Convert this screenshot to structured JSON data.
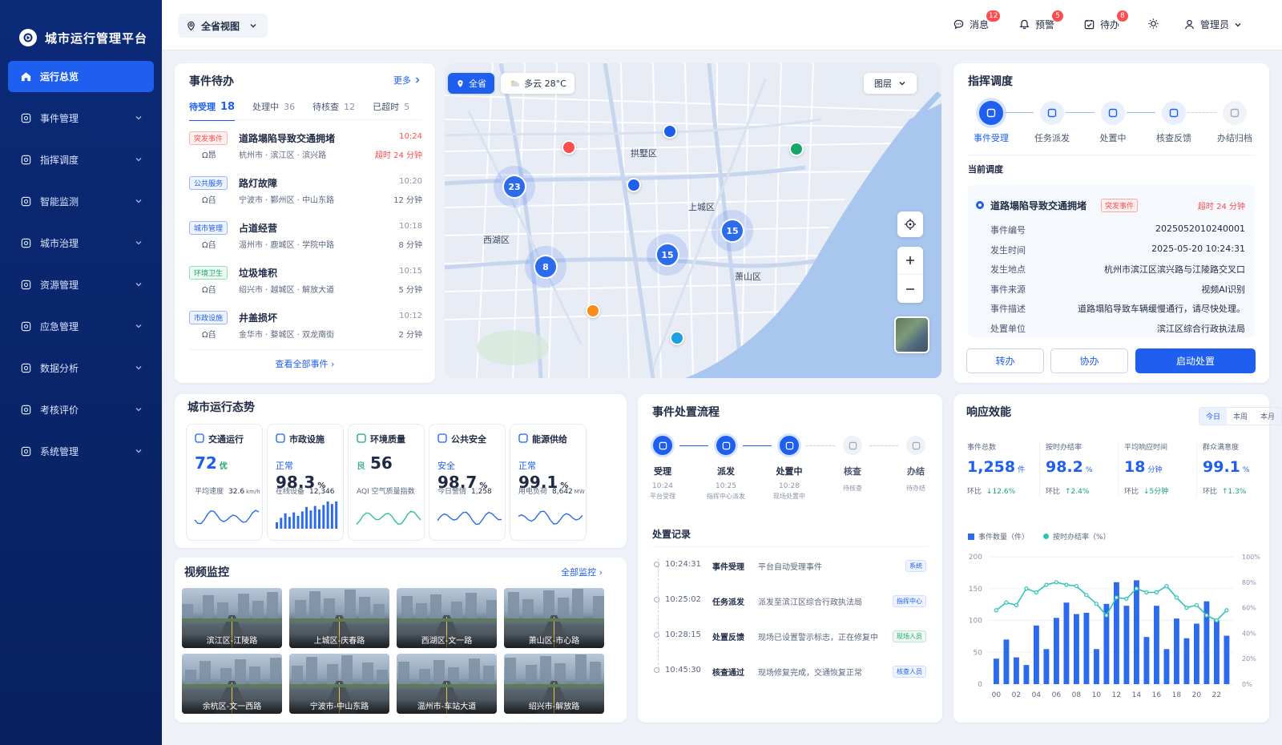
{
  "app": {
    "title": "城市运行管理平台"
  },
  "sidebar": {
    "items": [
      {
        "label": "运行总览",
        "icon": "home-icon",
        "active": true
      },
      {
        "label": "事件管理",
        "icon": "clipboard-icon"
      },
      {
        "label": "指挥调度",
        "icon": "command-icon"
      },
      {
        "label": "智能监测",
        "icon": "monitor-icon"
      },
      {
        "label": "城市治理",
        "icon": "city-icon"
      },
      {
        "label": "资源管理",
        "icon": "resource-icon"
      },
      {
        "label": "应急管理",
        "icon": "shield-icon"
      },
      {
        "label": "数据分析",
        "icon": "chart-icon"
      },
      {
        "label": "考核评价",
        "icon": "check-icon"
      },
      {
        "label": "系统管理",
        "icon": "gear-icon"
      }
    ]
  },
  "topbar": {
    "region": "全省视图",
    "messages": {
      "label": "消息",
      "count": "12"
    },
    "alerts": {
      "label": "预警",
      "count": "5"
    },
    "todo": {
      "label": "待办",
      "count": "8"
    },
    "user": "管理员"
  },
  "events": {
    "title": "事件待办",
    "more": "更多",
    "tabs": [
      {
        "label": "待受理",
        "count": "18"
      },
      {
        "label": "处理中",
        "count": "36"
      },
      {
        "label": "待核查",
        "count": "12"
      },
      {
        "label": "已超时",
        "count": "5"
      }
    ],
    "items": [
      {
        "tag": "突发事件",
        "tagColor": "#ff4d4f",
        "title": "道路塌陷导致交通拥堵",
        "sub": "Ω昂",
        "loc": "杭州市 · 滨江区 · 滨兴路",
        "time": "10:24",
        "dur": "超时 24 分钟",
        "durColor": "#ff4d4f"
      },
      {
        "tag": "公共服务",
        "tagColor": "#1e5ff0",
        "title": "路灯故障",
        "sub": "Ω臽",
        "loc": "宁波市 · 鄞州区 · 中山东路",
        "time": "10:20",
        "dur": "12 分钟",
        "durColor": "#5b6680"
      },
      {
        "tag": "城市管理",
        "tagColor": "#1e5ff0",
        "title": "占道经营",
        "sub": "Ω臽",
        "loc": "温州市 · 鹿城区 · 学院中路",
        "time": "10:18",
        "dur": "8 分钟",
        "durColor": "#5b6680"
      },
      {
        "tag": "环境卫生",
        "tagColor": "#17a66a",
        "title": "垃圾堆积",
        "sub": "Ω臽",
        "loc": "绍兴市 · 越城区 · 解放大道",
        "time": "10:15",
        "dur": "5 分钟",
        "durColor": "#5b6680"
      },
      {
        "tag": "市政设施",
        "tagColor": "#1e5ff0",
        "title": "井盖损坏",
        "sub": "Ω臽",
        "loc": "金华市 · 婺城区 · 双龙南街",
        "time": "10:12",
        "dur": "2 分钟",
        "durColor": "#5b6680"
      }
    ],
    "view_all": "查看全部事件"
  },
  "map": {
    "scope": "全省",
    "weather": "多云 28°C",
    "layers": "图层",
    "districts": [
      "拱墅区",
      "上城区",
      "西湖区",
      "萧山区"
    ],
    "clusters": [
      "23",
      "15",
      "15",
      "8"
    ]
  },
  "dispatch": {
    "title": "指挥调度",
    "steps": [
      "事件受理",
      "任务派发",
      "处置中",
      "核查反馈",
      "办结归档"
    ],
    "current_label": "当前调度",
    "event_title": "道路塌陷导致交通拥堵",
    "event_tag": "突发事件",
    "event_overdue": "超时 24 分钟",
    "fields": [
      {
        "k": "事件编号",
        "v": "2025052010240001"
      },
      {
        "k": "发生时间",
        "v": "2025-05-20  10:24:31"
      },
      {
        "k": "发生地点",
        "v": "杭州市滨江区滨兴路与江陵路交叉口"
      },
      {
        "k": "事件来源",
        "v": "视频AI识别"
      },
      {
        "k": "事件描述",
        "v": "道路塌陷导致车辆缓慢通行，请尽快处理。"
      },
      {
        "k": "处置单位",
        "v": "滨江区综合行政执法局"
      }
    ],
    "btn_transfer": "转办",
    "btn_assist": "协办",
    "btn_start": "启动处置"
  },
  "situation": {
    "title": "城市运行态势",
    "cards": [
      {
        "name": "交通运行",
        "prefix": "",
        "value": "72",
        "suffix": "优",
        "sub_label": "平均速度",
        "sub_value": "32.6",
        "sub_unit": "km/h"
      },
      {
        "name": "市政设施",
        "prefix": "正常",
        "value": "98.3",
        "suffix": "%",
        "sub_label": "在线设备",
        "sub_value": "12,346",
        "sub_unit": ""
      },
      {
        "name": "环境质量",
        "prefix": "良",
        "value": "56",
        "suffix": "",
        "sub_label": "AQI 空气质量指数",
        "sub_value": "",
        "sub_unit": ""
      },
      {
        "name": "公共安全",
        "prefix": "安全",
        "value": "98.7",
        "suffix": "%",
        "sub_label": "今日警情",
        "sub_value": "1,258",
        "sub_unit": ""
      },
      {
        "name": "能源供给",
        "prefix": "正常",
        "value": "99.1",
        "suffix": "%",
        "sub_label": "用电负荷",
        "sub_value": "8,642",
        "sub_unit": "MW"
      }
    ]
  },
  "flow": {
    "title": "事件处置流程",
    "steps": [
      {
        "name": "受理",
        "time": "10:24",
        "who": "平台受理"
      },
      {
        "name": "派发",
        "time": "10:25",
        "who": "指挥中心派发"
      },
      {
        "name": "处置中",
        "time": "10:28",
        "who": "现场处置中"
      },
      {
        "name": "核查",
        "time": "",
        "who": "待核查"
      },
      {
        "name": "办结",
        "time": "",
        "who": "待办结"
      }
    ],
    "records_title": "处置记录",
    "records": [
      {
        "time": "10:24:31",
        "action": "事件受理",
        "desc": "平台自动受理事件",
        "tag": "系统"
      },
      {
        "time": "10:25:02",
        "action": "任务派发",
        "desc": "派发至滨江区综合行政执法局",
        "tag": "指挥中心"
      },
      {
        "time": "10:28:15",
        "action": "处置反馈",
        "desc": "现场已设置警示标志，正在修复中",
        "tag": "现场人员"
      },
      {
        "time": "10:45:30",
        "action": "核查通过",
        "desc": "现场修复完成，交通恢复正常",
        "tag": "核查人员"
      }
    ]
  },
  "video": {
    "title": "视频监控",
    "all": "全部监控",
    "cams": [
      "滨江区-江陵路",
      "上城区-庆春路",
      "西湖区-文一路",
      "萧山区-市心路",
      "余杭区-文一西路",
      "宁波市-中山东路",
      "温州市-车站大道",
      "绍兴市-解放路"
    ]
  },
  "response": {
    "title": "响应效能",
    "periods": [
      "今日",
      "本周",
      "本月"
    ],
    "metrics": [
      {
        "label": "事件总数",
        "value": "1,258",
        "unit": "件",
        "trend_label": "环比",
        "trend": "↓12.6%"
      },
      {
        "label": "按时办结率",
        "value": "98.2",
        "unit": "%",
        "trend_label": "环比",
        "trend": "↑2.4%"
      },
      {
        "label": "平均响应时间",
        "value": "18",
        "unit": "分钟",
        "trend_label": "环比",
        "trend": "↓5分钟"
      },
      {
        "label": "群众满意度",
        "value": "99.1",
        "unit": "%",
        "trend_label": "环比",
        "trend": "↑1.3%"
      }
    ]
  },
  "chart_data": {
    "type": "bar",
    "legend": [
      "事件数量（件）",
      "按时办结率（%）"
    ],
    "x": [
      "00",
      "01",
      "02",
      "03",
      "04",
      "05",
      "06",
      "07",
      "08",
      "09",
      "10",
      "11",
      "12",
      "13",
      "14",
      "15",
      "16",
      "17",
      "18",
      "19",
      "20",
      "21",
      "22",
      "23"
    ],
    "xticks": [
      "00",
      "02",
      "04",
      "06",
      "08",
      "10",
      "12",
      "14",
      "16",
      "18",
      "20",
      "22"
    ],
    "series": [
      {
        "name": "事件数量（件）",
        "type": "bar",
        "axis": "left",
        "values": [
          40,
          70,
          42,
          30,
          92,
          55,
          104,
          128,
          110,
          112,
          55,
          126,
          160,
          123,
          163,
          74,
          123,
          55,
          103,
          72,
          95,
          130,
          100,
          76
        ]
      },
      {
        "name": "按时办结率（%）",
        "type": "line",
        "axis": "right",
        "values": [
          58,
          64,
          62,
          75,
          72,
          78,
          80,
          78,
          77,
          70,
          63,
          54,
          68,
          67,
          75,
          72,
          72,
          77,
          68,
          60,
          62,
          54,
          50,
          58
        ]
      }
    ],
    "yleft": {
      "ticks": [
        "0",
        "50",
        "100",
        "150",
        "200"
      ],
      "lim": [
        0,
        200
      ]
    },
    "yright": {
      "ticks": [
        "0%",
        "20%",
        "40%",
        "60%",
        "80%",
        "100%"
      ],
      "lim": [
        0,
        100
      ]
    },
    "colors": {
      "bar": "#2c6bec",
      "line": "#2ec4b6"
    }
  }
}
